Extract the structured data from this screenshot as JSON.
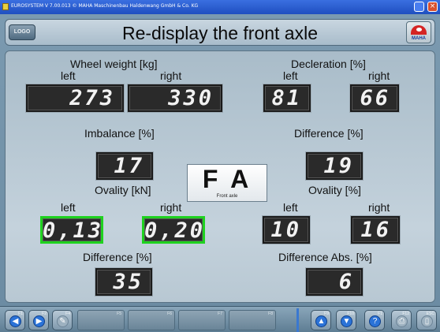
{
  "window": {
    "title": "EUROSYSTEM  V 7.00.013  © MAHA Maschinenbau Haldenwang GmbH & Co. KG",
    "close_glyph": "×"
  },
  "header": {
    "logo_label": "LOGO",
    "title": "Re-display the front axle",
    "brand_icon": "maha-logo-icon",
    "brand_text": "MAHA"
  },
  "wheel_weight": {
    "label": "Wheel weight [kg]",
    "left_label": "left",
    "right_label": "right",
    "left": "273",
    "right": "330"
  },
  "deceleration": {
    "label": "Decleration [%]",
    "left_label": "left",
    "right_label": "right",
    "left": "81",
    "right": "66"
  },
  "imbalance": {
    "label": "Imbalance [%]",
    "value": "17"
  },
  "difference": {
    "label": "Difference [%]",
    "value": "19"
  },
  "axle_badge": {
    "big": "F A",
    "small": "Front axle"
  },
  "ovality_kn": {
    "label": "Ovality [kN]",
    "left_label": "left",
    "right_label": "right",
    "left": "0,13",
    "right": "0,20",
    "highlight_color": "#1fd21f"
  },
  "ovality_pct": {
    "label": "Ovality [%]",
    "left_label": "left",
    "right_label": "right",
    "left": "10",
    "right": "16"
  },
  "difference_bottom": {
    "label": "Difference [%]",
    "value": "35"
  },
  "difference_abs": {
    "label": "Difference Abs. [%]",
    "value": "6"
  },
  "toolbar": {
    "keys": [
      {
        "key": "F1",
        "icon": "arrow-left-icon",
        "glyph": "◀"
      },
      {
        "key": "F2",
        "icon": "arrow-right-icon",
        "glyph": "▶"
      },
      {
        "key": "F4",
        "icon": "wrench-icon",
        "glyph": "✎"
      },
      {
        "key": "F5",
        "glyph": ""
      },
      {
        "key": "F6",
        "glyph": ""
      },
      {
        "key": "F7",
        "glyph": ""
      },
      {
        "key": "F8",
        "glyph": ""
      },
      {
        "key": "F9",
        "icon": "up-arrow-icon",
        "glyph": "▲"
      },
      {
        "key": "F10",
        "icon": "down-arrow-icon",
        "glyph": "▼"
      },
      {
        "key": "F1",
        "icon": "help-icon",
        "glyph": "?"
      },
      {
        "key": "F12",
        "icon": "print-icon",
        "glyph": "⎙"
      },
      {
        "key": "ESC",
        "icon": "exit-door-icon",
        "glyph": "▯"
      }
    ]
  },
  "colors": {
    "display_bg": "#2a2a2a",
    "display_fg": "#f2f2f2",
    "accent": "#2b73d8"
  }
}
